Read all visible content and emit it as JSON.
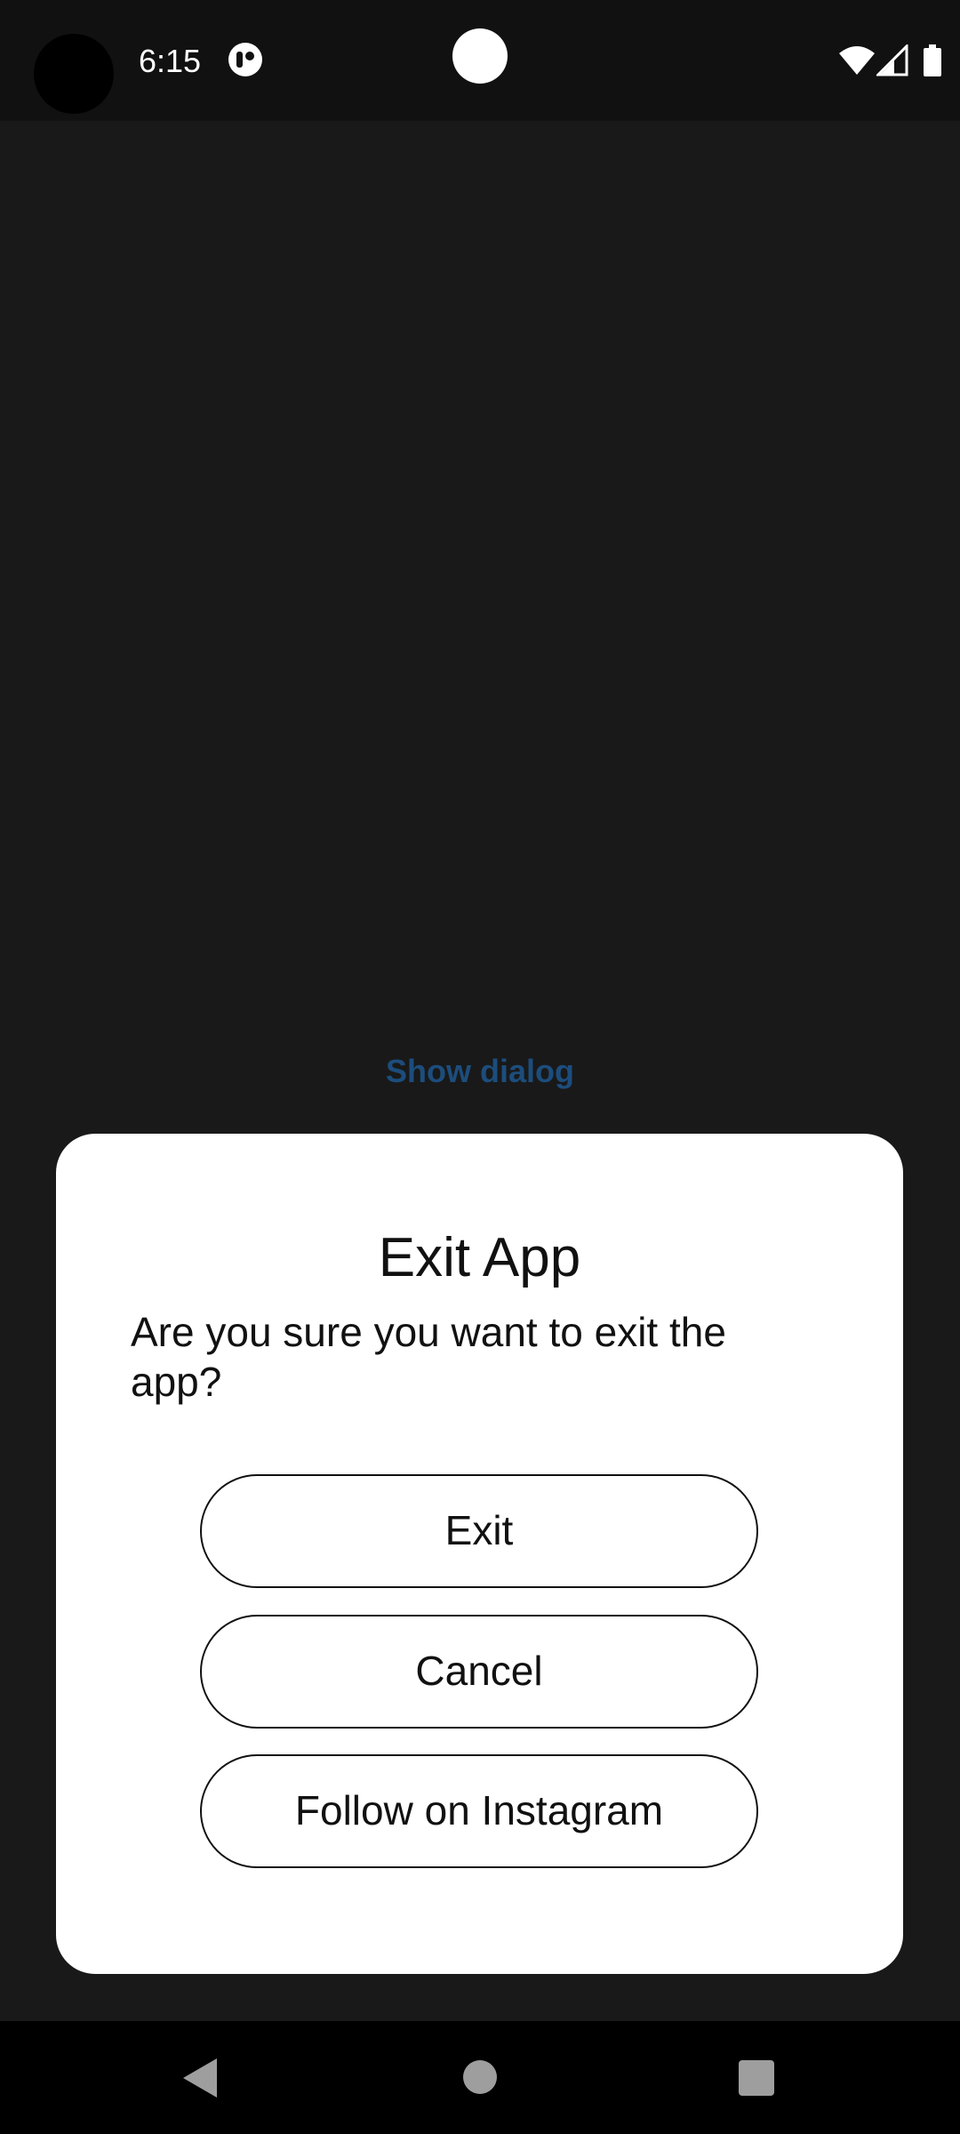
{
  "status_bar": {
    "time": "6:15",
    "icons": [
      "notification-app-icon",
      "wifi-icon",
      "cellular-signal-icon",
      "battery-icon"
    ]
  },
  "main": {
    "show_dialog_label": "Show dialog"
  },
  "dialog": {
    "title": "Exit App",
    "message": "Are you sure you want to exit the app?",
    "buttons": {
      "exit": "Exit",
      "cancel": "Cancel",
      "instagram": "Follow on Instagram"
    }
  },
  "nav_bar": {
    "icons": [
      "back-icon",
      "home-icon",
      "recents-icon"
    ]
  },
  "colors": {
    "background": "#191919",
    "status_bar": "#111111",
    "dialog": "#ffffff",
    "link_text": "#1c4d7c",
    "nav_icon": "#9e9e9e"
  }
}
